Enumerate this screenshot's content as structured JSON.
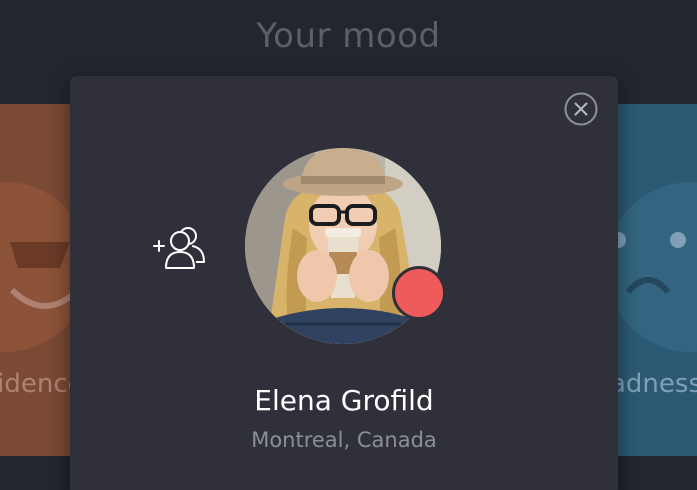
{
  "header": {
    "title": "Your mood"
  },
  "background_cards": {
    "left": {
      "label": "fidence",
      "icon": "cool-face-icon",
      "color": "#7a4a35"
    },
    "right": {
      "label": "adness",
      "icon": "sad-face-icon",
      "color": "#2c5a74"
    }
  },
  "profile": {
    "name": "Elena Grofild",
    "location": "Montreal, Canada",
    "status_color": "#ef5b5b",
    "avatar_icon": "user-photo"
  },
  "controls": {
    "close_icon": "close-icon",
    "add_friend_icon": "add-friend-icon"
  }
}
